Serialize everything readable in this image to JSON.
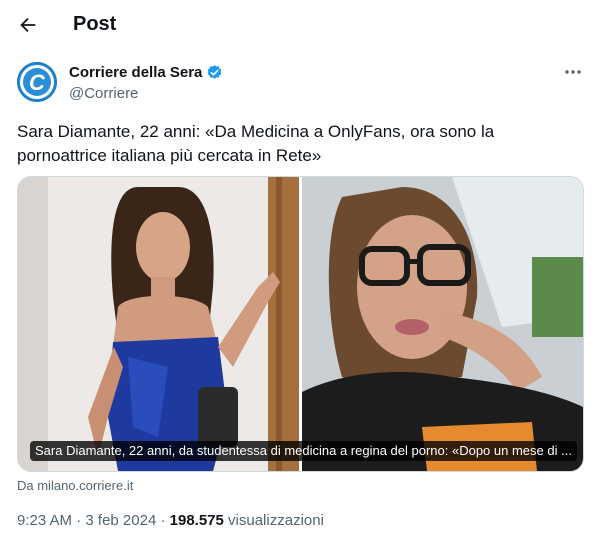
{
  "header": {
    "title": "Post"
  },
  "author": {
    "name": "Corriere della Sera",
    "handle": "@Corriere",
    "avatar_letter": "C"
  },
  "tweet": {
    "text": "Sara Diamante, 22 anni: «Da Medicina a OnlyFans, ora sono la pornoattrice italiana più cercata in Rete»"
  },
  "card": {
    "caption": "Sara Diamante, 22 anni, da studentessa di medicina a regina del porno: «Dopo un mese di ...",
    "source": "Da milano.corriere.it"
  },
  "meta": {
    "time": "9:23 AM",
    "sep": " · ",
    "date": "3 feb 2024",
    "sep2": " · ",
    "views": "198.575",
    "views_label": " visualizzazioni"
  },
  "colors": {
    "accent": "#1d9bf0",
    "avatar": "#2a8fd8",
    "secondary_text": "#536471"
  },
  "icons": {
    "back": "arrow-left-icon",
    "verified": "verified-badge-icon",
    "more": "more-dots-icon"
  }
}
